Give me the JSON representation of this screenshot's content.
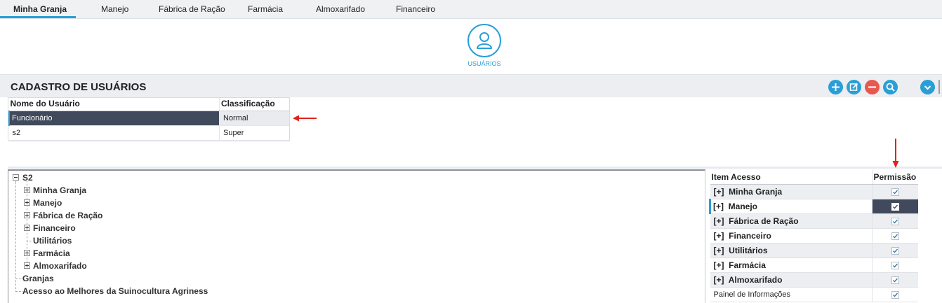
{
  "nav": {
    "tabs": [
      {
        "label": "Minha Granja",
        "active": true
      },
      {
        "label": "Manejo"
      },
      {
        "label": "Fábrica de Ração"
      },
      {
        "label": "Farmácia"
      },
      {
        "label": "Almoxarifado"
      },
      {
        "label": "Financeiro"
      }
    ]
  },
  "hero": {
    "label": "USUÁRIOS",
    "icon": "user-icon"
  },
  "panel": {
    "title": "CADASTRO DE USUÁRIOS",
    "buttons": [
      {
        "icon": "plus-icon",
        "color": "#2a9fd6"
      },
      {
        "icon": "edit-icon",
        "color": "#2a9fd6"
      },
      {
        "icon": "minus-icon",
        "color": "#e8584f"
      },
      {
        "icon": "search-icon",
        "color": "#2a9fd6"
      },
      {
        "icon": "chevron-down-icon",
        "color": "#2a9fd6"
      }
    ]
  },
  "users": {
    "columns": [
      "Nome do Usuário",
      "Classificação"
    ],
    "rows": [
      {
        "name": "Funcionário",
        "class": "Normal",
        "selected": true
      },
      {
        "name": "s2",
        "class": "Super"
      }
    ]
  },
  "tree": {
    "root": "S2",
    "children": [
      "Minha Granja",
      "Manejo",
      "Fábrica de Ração",
      "Financeiro",
      "Utilitários",
      "Farmácia",
      "Almoxarifado"
    ],
    "top_level": [
      "Granjas",
      "Acesso ao Melhores da Suinocultura Agriness"
    ]
  },
  "permissions": {
    "columns": [
      "Item Acesso",
      "Permissão"
    ],
    "rows": [
      {
        "prefix": "[+]",
        "label": "Minha Granja",
        "checked": true
      },
      {
        "prefix": "[+]",
        "label": "Manejo",
        "checked": true,
        "selected": true
      },
      {
        "prefix": "[+]",
        "label": "Fábrica de Ração",
        "checked": true
      },
      {
        "prefix": "[+]",
        "label": "Financeiro",
        "checked": true
      },
      {
        "prefix": "[+]",
        "label": "Utilitários",
        "checked": true
      },
      {
        "prefix": "[+]",
        "label": "Farmácia",
        "checked": true
      },
      {
        "prefix": "[+]",
        "label": "Almoxarifado",
        "checked": true
      },
      {
        "prefix": "",
        "label": "Painel de Informações",
        "checked": true
      }
    ]
  },
  "colors": {
    "accent": "#2a9fd6",
    "selected_row": "#404a5c",
    "arrow": "#e2231a",
    "delete": "#e8584f"
  }
}
